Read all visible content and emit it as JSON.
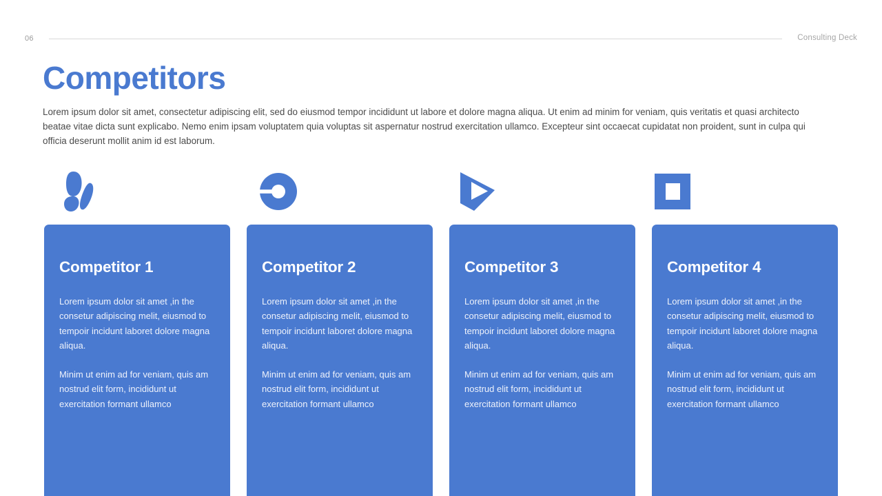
{
  "header": {
    "page_number": "06",
    "deck_name": "Consulting Deck"
  },
  "title": "Competitors",
  "intro": "Lorem ipsum dolor sit amet, consectetur adipiscing elit, sed do eiusmod tempor incididunt ut labore et dolore magna aliqua. Ut enim ad minim for veniam, quis veritatis et quasi architecto beatae vitae dicta sunt explicabo. Nemo enim ipsam voluptatem quia voluptas sit aspernatur nostrud exercitation ullamco. Excepteur sint occaecat cupidatat non proident, sunt in culpa qui officia deserunt mollit anim id est laborum.",
  "colors": {
    "brand_blue": "#4a7ad0",
    "card_blue": "#4a7ad0",
    "title_blue": "#4a7ad0",
    "body_text": "#4a4a4a",
    "muted_gray": "#a6a6a6",
    "rule_gray": "#d9d9d9"
  },
  "icons": [
    {
      "name": "butterfly-icon"
    },
    {
      "name": "circle-tag-icon"
    },
    {
      "name": "play-arrow-icon"
    },
    {
      "name": "square-frame-icon"
    }
  ],
  "cards": [
    {
      "title": "Competitor 1",
      "paragraph1": "Lorem ipsum dolor sit amet ,in the consetur adipiscing melit, eiusmod to tempoir incidunt laboret dolore magna aliqua.",
      "paragraph2": "Minim ut enim ad for veniam, quis am nostrud elit form, incididunt ut exercitation formant ullamco"
    },
    {
      "title": "Competitor 2",
      "paragraph1": "Lorem ipsum dolor sit amet ,in the consetur adipiscing melit, eiusmod to tempoir incidunt laboret dolore magna aliqua.",
      "paragraph2": "Minim ut enim ad for veniam, quis am nostrud elit form, incididunt ut exercitation formant ullamco"
    },
    {
      "title": "Competitor 3",
      "paragraph1": "Lorem ipsum dolor sit amet ,in the consetur adipiscing melit, eiusmod to tempoir incidunt laboret dolore magna aliqua.",
      "paragraph2": "Minim ut enim ad for veniam, quis am nostrud elit form, incididunt ut exercitation formant ullamco"
    },
    {
      "title": "Competitor 4",
      "paragraph1": "Lorem ipsum dolor sit amet ,in the consetur adipiscing melit, eiusmod to tempoir incidunt laboret dolore magna aliqua.",
      "paragraph2": "Minim ut enim ad for veniam, quis am nostrud elit form, incididunt ut exercitation formant ullamco"
    }
  ]
}
